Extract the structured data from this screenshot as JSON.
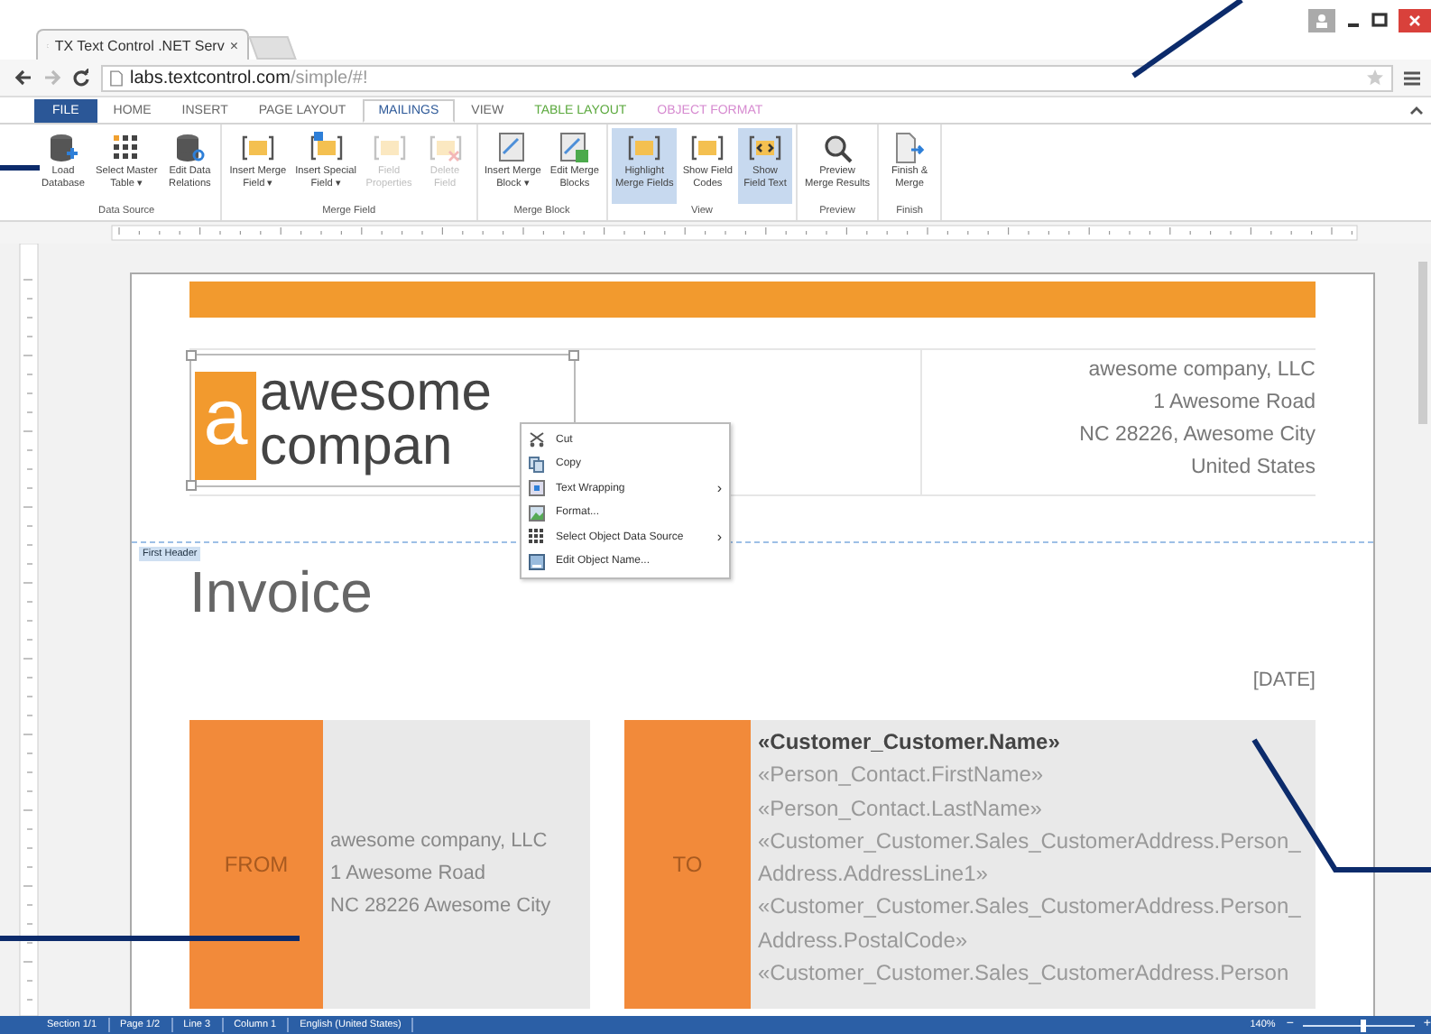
{
  "browser": {
    "tab_title": "TX Text Control .NET Serv",
    "tab_close": "×",
    "url_host": "labs.textcontrol.com",
    "url_path": "/simple/#!"
  },
  "ribbon_tabs": [
    {
      "label": "FILE",
      "kind": "file",
      "selected": false
    },
    {
      "label": "HOME",
      "kind": "plain",
      "selected": false
    },
    {
      "label": "INSERT",
      "kind": "plain",
      "selected": false
    },
    {
      "label": "PAGE LAYOUT",
      "kind": "plain",
      "selected": false
    },
    {
      "label": "MAILINGS",
      "kind": "plain",
      "selected": true
    },
    {
      "label": "VIEW",
      "kind": "plain",
      "selected": false
    },
    {
      "label": "TABLE LAYOUT",
      "kind": "context",
      "color": "#5aa83c",
      "selected": false
    },
    {
      "label": "OBJECT FORMAT",
      "kind": "context",
      "color": "#d68ad0",
      "selected": false
    }
  ],
  "ribbon_groups": [
    {
      "name": "Data Source",
      "buttons": [
        {
          "lines": [
            "Load",
            "Database"
          ],
          "disabled": false,
          "on": false
        },
        {
          "lines": [
            "Select Master",
            "Table ▾"
          ],
          "disabled": false,
          "on": false
        },
        {
          "lines": [
            "Edit Data",
            "Relations"
          ],
          "disabled": false,
          "on": false
        }
      ]
    },
    {
      "name": "Merge Field",
      "buttons": [
        {
          "lines": [
            "Insert Merge",
            "Field ▾"
          ],
          "disabled": false,
          "on": false
        },
        {
          "lines": [
            "Insert Special",
            "Field ▾"
          ],
          "disabled": false,
          "on": false
        },
        {
          "lines": [
            "Field",
            "Properties"
          ],
          "disabled": true,
          "on": false
        },
        {
          "lines": [
            "Delete",
            "Field"
          ],
          "disabled": true,
          "on": false
        }
      ]
    },
    {
      "name": "Merge Block",
      "buttons": [
        {
          "lines": [
            "Insert Merge",
            "Block ▾"
          ],
          "disabled": false,
          "on": false
        },
        {
          "lines": [
            "Edit Merge",
            "Blocks"
          ],
          "disabled": false,
          "on": false
        }
      ]
    },
    {
      "name": "View",
      "buttons": [
        {
          "lines": [
            "Highlight",
            "Merge Fields"
          ],
          "disabled": false,
          "on": true
        },
        {
          "lines": [
            "Show Field",
            "Codes"
          ],
          "disabled": false,
          "on": false
        },
        {
          "lines": [
            "Show",
            "Field Text"
          ],
          "disabled": false,
          "on": true
        }
      ]
    },
    {
      "name": "Preview",
      "buttons": [
        {
          "lines": [
            "Preview",
            "Merge Results"
          ],
          "disabled": false,
          "on": false
        }
      ]
    },
    {
      "name": "Finish",
      "buttons": [
        {
          "lines": [
            "Finish &",
            "Merge"
          ],
          "disabled": false,
          "on": false
        }
      ]
    }
  ],
  "document": {
    "logo_letter": "a",
    "logo_line_1": "awesome",
    "logo_line_2": "compan",
    "company_address": [
      "awesome company, LLC",
      "1 Awesome Road",
      "NC 28226, Awesome City",
      "United States"
    ],
    "header_label": "First Header",
    "title": "Invoice",
    "date": "[DATE]",
    "from_label": "FROM",
    "from_address": [
      "awesome company, LLC",
      "1 Awesome Road",
      "NC 28226 Awesome City"
    ],
    "to_label": "TO",
    "to_fields": [
      {
        "text": "«Customer_Customer.Name»",
        "kind": "name"
      },
      {
        "text": "«Person_Contact.FirstName»",
        "kind": "field"
      },
      {
        "text": "«Person_Contact.LastName»",
        "kind": "field"
      },
      {
        "text": "«Customer_Customer.Sales_CustomerAddress.Person_",
        "kind": "field"
      },
      {
        "text": "Address.AddressLine1»",
        "kind": "field"
      },
      {
        "text": "«Customer_Customer.Sales_CustomerAddress.Person_",
        "kind": "field"
      },
      {
        "text": "Address.PostalCode»",
        "kind": "field"
      },
      {
        "text": "«Customer_Customer.Sales_CustomerAddress.Person",
        "kind": "field"
      }
    ]
  },
  "context_menu": [
    {
      "label": "Cut",
      "submenu": false
    },
    {
      "label": "Copy",
      "submenu": false
    },
    {
      "label": "Text Wrapping",
      "submenu": true
    },
    {
      "label": "Format...",
      "submenu": false
    },
    {
      "label": "Select Object Data Source",
      "submenu": true
    },
    {
      "label": "Edit Object Name...",
      "submenu": false
    }
  ],
  "context_menu_arrow": "›",
  "status_bar": {
    "items": [
      "Section 1/1",
      "Page 1/2",
      "Line 3",
      "Column 1",
      "English (United States)"
    ],
    "zoom": "140%",
    "zoom_out": "−",
    "zoom_in": "+",
    "zoom_slider": {
      "level": 0.55
    }
  }
}
